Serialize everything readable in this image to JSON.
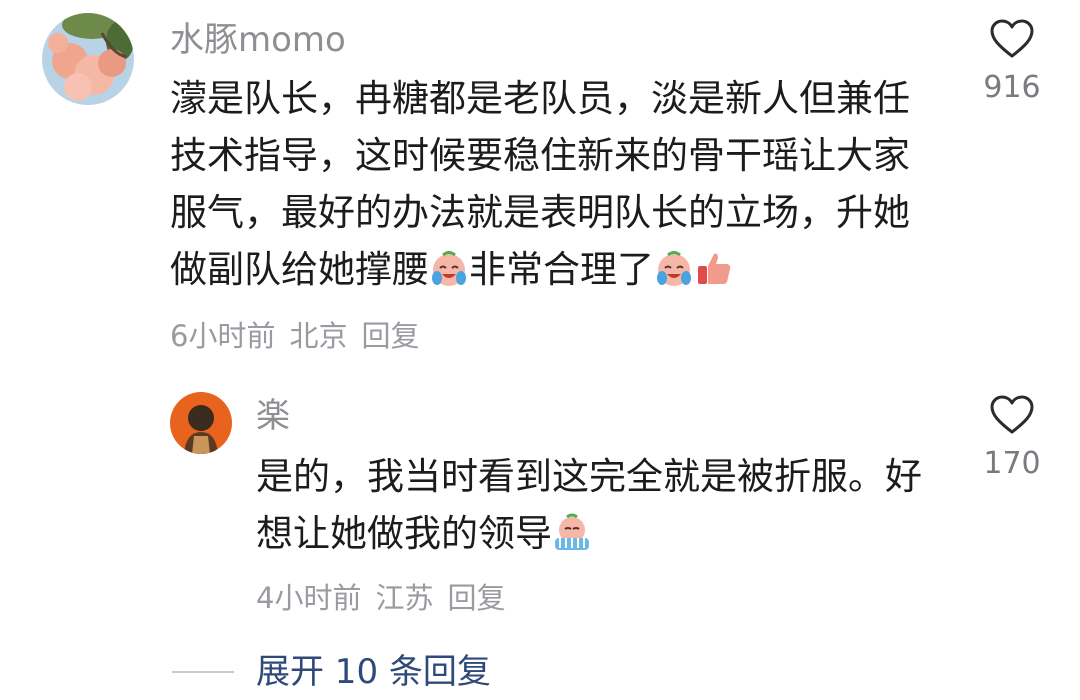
{
  "comment": {
    "username": "水豚momo",
    "lines": [
      "濛是队长，冉糖都是老队员，淡是新人但兼任",
      "技术指导，这时候要稳住新来的骨干瑶让大家",
      "服气，最好的办法就是表明队长的立场，升她",
      "做副队给她撑腰",
      "非常合理了"
    ],
    "time": "6小时前",
    "location": "北京",
    "reply_label": "回复",
    "like_count": "916"
  },
  "reply": {
    "username": "楽",
    "lines": [
      "是的，我当时看到这完全就是被折服。好",
      "想让她做我的领导"
    ],
    "time": "4小时前",
    "location": "江苏",
    "reply_label": "回复",
    "like_count": "170"
  },
  "expand": {
    "label": "展开 10 条回复"
  },
  "icons": {
    "like": "heart-outline-icon",
    "crying_emoji": "crying-laughing-emoji-icon",
    "thumbs_up": "thumbs-up-icon",
    "crying_flat_emoji": "crying-emoji-icon"
  }
}
